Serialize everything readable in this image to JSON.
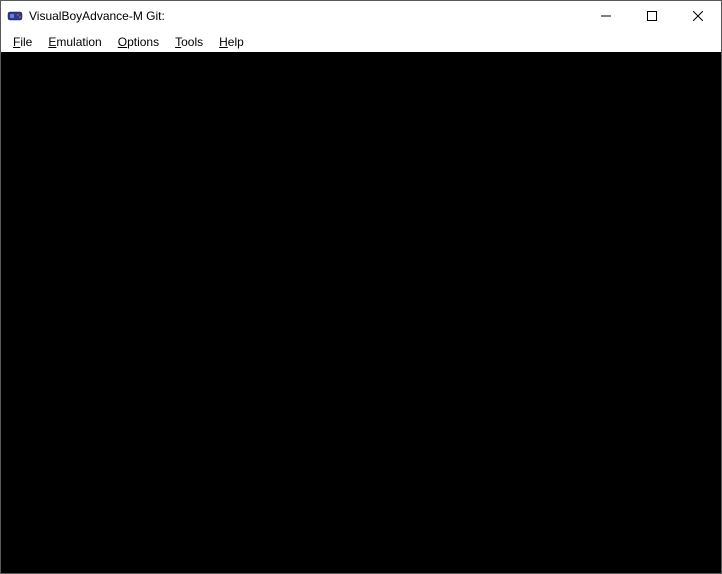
{
  "window": {
    "title": "VisualBoyAdvance-M Git:"
  },
  "menubar": {
    "items": [
      {
        "label": "File",
        "accel_index": 0
      },
      {
        "label": "Emulation",
        "accel_index": 0
      },
      {
        "label": "Options",
        "accel_index": 0
      },
      {
        "label": "Tools",
        "accel_index": 0
      },
      {
        "label": "Help",
        "accel_index": 0
      }
    ]
  },
  "content": {
    "background_color": "#000000"
  }
}
